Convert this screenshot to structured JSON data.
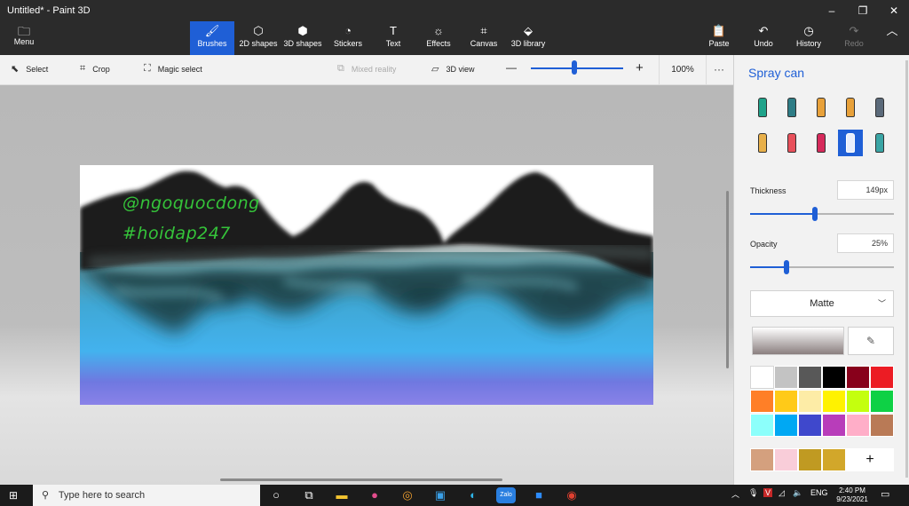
{
  "window": {
    "title": "Untitled* - Paint 3D",
    "controls": [
      "–",
      "❐",
      "✕"
    ]
  },
  "menu": {
    "label": "Menu"
  },
  "ribbon": {
    "tools": [
      {
        "label": "Brushes",
        "icon": "brush-icon",
        "glyph": "🖌",
        "active": true
      },
      {
        "label": "2D shapes",
        "icon": "2d-shapes-icon",
        "glyph": "⬡"
      },
      {
        "label": "3D shapes",
        "icon": "3d-shapes-icon",
        "glyph": "⬢"
      },
      {
        "label": "Stickers",
        "icon": "stickers-icon",
        "glyph": "◔"
      },
      {
        "label": "Text",
        "icon": "text-icon",
        "glyph": "T"
      },
      {
        "label": "Effects",
        "icon": "effects-icon",
        "glyph": "☼"
      },
      {
        "label": "Canvas",
        "icon": "canvas-icon",
        "glyph": "⌗"
      },
      {
        "label": "3D library",
        "icon": "3d-library-icon",
        "glyph": "⬙"
      }
    ],
    "actions": [
      {
        "label": "Paste",
        "icon": "paste-icon",
        "glyph": "📋"
      },
      {
        "label": "Undo",
        "icon": "undo-icon",
        "glyph": "↶"
      },
      {
        "label": "History",
        "icon": "history-icon",
        "glyph": "◷"
      },
      {
        "label": "Redo",
        "icon": "redo-icon",
        "glyph": "↷",
        "disabled": true
      }
    ],
    "collapse_glyph": "︿"
  },
  "subtoolbar": {
    "select": "Select",
    "crop": "Crop",
    "magic_select": "Magic select",
    "mixed_reality": "Mixed reality",
    "view_3d": "3D view",
    "zoom_minus": "—",
    "zoom_plus": "+",
    "zoom_level": "100%",
    "zoom_fraction": 0.47,
    "more": "···"
  },
  "canvas": {
    "watermark_line1": "@ngoquocdong",
    "watermark_line2": "#hoidap247"
  },
  "panel": {
    "title": "Spray can",
    "brushes": [
      {
        "name": "marker-icon",
        "color": "#1fa38a"
      },
      {
        "name": "calligraphy-pen-icon",
        "color": "#2e7d86"
      },
      {
        "name": "oil-brush-icon",
        "color": "#e8a13a"
      },
      {
        "name": "watercolor-icon",
        "color": "#e8a13a"
      },
      {
        "name": "pixel-pen-icon",
        "color": "#5b6a7a"
      },
      {
        "name": "pencil-icon",
        "color": "#e8b04a"
      },
      {
        "name": "eraser-icon",
        "color": "#e8505b"
      },
      {
        "name": "crayon-icon",
        "color": "#d62a5b"
      },
      {
        "name": "spray-can-icon",
        "color": "#1f5fd6",
        "selected": true
      },
      {
        "name": "fill-icon",
        "color": "#3aa5a5"
      }
    ],
    "thickness_label": "Thickness",
    "thickness_value": "149px",
    "thickness_fraction": 0.45,
    "opacity_label": "Opacity",
    "opacity_value": "25%",
    "opacity_fraction": 0.25,
    "finish": "Matte",
    "colors": [
      "#ffffff",
      "#c3c3c3",
      "#585858",
      "#000000",
      "#88001b",
      "#ec1c24",
      "#ff7f27",
      "#ffca18",
      "#fdeca6",
      "#fff200",
      "#c4ff0e",
      "#0ed145",
      "#8cfffb",
      "#00a8f3",
      "#3f48cc",
      "#b83dba",
      "#ffaec8",
      "#b97a56",
      "#d4a07e",
      "#f9cdd9",
      "#c09a22",
      "#d2a72a"
    ],
    "add_color": "+"
  },
  "taskbar": {
    "search_placeholder": "Type here to search",
    "apps": [
      {
        "name": "cortana-icon",
        "glyph": "○"
      },
      {
        "name": "task-view-icon",
        "glyph": "⧉"
      },
      {
        "name": "file-explorer-icon",
        "glyph": "▬",
        "color": "#f4c430"
      },
      {
        "name": "paint-drop-icon",
        "glyph": "●",
        "color": "#e24d8c"
      },
      {
        "name": "media-icon",
        "glyph": "◎",
        "color": "#f0a030"
      },
      {
        "name": "photos-icon",
        "glyph": "▣",
        "color": "#3aa0e8"
      },
      {
        "name": "edge-icon",
        "glyph": "◐",
        "color": "#2fb5e8"
      },
      {
        "name": "zalo-icon",
        "glyph": "Zalo",
        "color": "#2a7fe0"
      },
      {
        "name": "zoom-icon",
        "glyph": "■",
        "color": "#2d8cff"
      },
      {
        "name": "chrome-icon",
        "glyph": "◉",
        "color": "#e04030"
      }
    ],
    "tray": {
      "chevron": "︿",
      "lang": "ENG",
      "time": "2:40 PM",
      "date": "9/23/2021"
    }
  }
}
